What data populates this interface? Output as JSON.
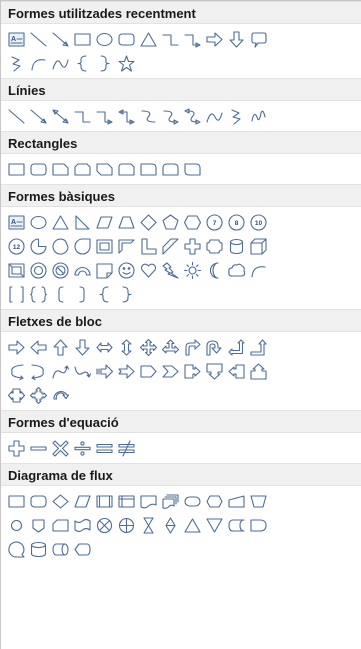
{
  "accent_color": "#4d6d95",
  "sections": [
    {
      "title": "Formes utilitzades recentment",
      "rows": [
        [
          "text-box",
          "line",
          "line-arrow",
          "rectangle",
          "oval",
          "rounded-rectangle",
          "triangle",
          "elbow-connector",
          "elbow-arrow-connector",
          "right-arrow",
          "down-arrow",
          "rounded-rectangle-callout"
        ],
        [
          "freeform",
          "arc",
          "curve",
          "left-brace",
          "right-brace",
          "star-5-point"
        ]
      ]
    },
    {
      "title": "Línies",
      "rows": [
        [
          "line",
          "line-arrow",
          "line-double-arrow",
          "elbow-connector",
          "elbow-arrow-connector",
          "elbow-double-arrow-connector",
          "curved-connector",
          "curved-arrow-connector",
          "curved-double-arrow-connector",
          "curve",
          "freeform",
          "scribble"
        ]
      ]
    },
    {
      "title": "Rectangles",
      "rows": [
        [
          "rectangle",
          "rounded-rectangle",
          "snip-single-corner",
          "snip-same-side",
          "snip-diagonal",
          "snip-round",
          "round-single-corner",
          "round-same-side",
          "round-diagonal"
        ]
      ]
    },
    {
      "title": "Formes bàsiques",
      "rows": [
        [
          "text-box",
          "oval",
          "triangle",
          "right-triangle",
          "parallelogram",
          "trapezoid",
          "diamond",
          "pentagon",
          "hexagon",
          "heptagon",
          "octagon",
          "decagon"
        ],
        [
          "dodecagon",
          "pie",
          "chord",
          "teardrop",
          "frame",
          "half-frame",
          "l-shape",
          "diagonal-stripe",
          "plus",
          "plaque",
          "can",
          "cube"
        ],
        [
          "bevel",
          "donut",
          "no-symbol",
          "block-arc",
          "folded-corner",
          "smiley-face",
          "heart",
          "lightning-bolt",
          "sun",
          "moon",
          "cloud",
          "arc"
        ],
        [
          "double-bracket",
          "double-brace",
          "left-bracket",
          "right-bracket",
          "left-brace",
          "right-brace"
        ]
      ]
    },
    {
      "title": "Fletxes de bloc",
      "rows": [
        [
          "right-arrow",
          "left-arrow",
          "up-arrow",
          "down-arrow",
          "left-right-arrow",
          "up-down-arrow",
          "quad-arrow",
          "left-right-up-arrow",
          "bent-arrow",
          "u-turn-arrow",
          "left-up-arrow",
          "bent-up-arrow"
        ],
        [
          "curved-right-arrow",
          "curved-left-arrow",
          "curved-up-arrow",
          "curved-down-arrow",
          "striped-right-arrow",
          "notched-right-arrow",
          "pentagon-arrow",
          "chevron",
          "right-arrow-callout",
          "down-arrow-callout",
          "left-arrow-callout",
          "up-arrow-callout"
        ],
        [
          "left-right-arrow-callout",
          "quad-arrow-callout",
          "circular-arrow"
        ]
      ]
    },
    {
      "title": "Formes d'equació",
      "rows": [
        [
          "plus",
          "minus",
          "multiply",
          "divide",
          "equal",
          "not-equal"
        ]
      ]
    },
    {
      "title": "Diagrama de flux",
      "rows": [
        [
          "flowchart-process",
          "flowchart-alternate-process",
          "flowchart-decision",
          "flowchart-data",
          "flowchart-predefined-process",
          "flowchart-internal-storage",
          "flowchart-document",
          "flowchart-multidocument",
          "flowchart-terminator",
          "flowchart-preparation",
          "flowchart-manual-input",
          "flowchart-manual-operation"
        ],
        [
          "flowchart-connector",
          "flowchart-offpage-connector",
          "flowchart-card",
          "flowchart-punched-tape",
          "flowchart-summing-junction",
          "flowchart-or",
          "flowchart-collate",
          "flowchart-sort",
          "flowchart-extract",
          "flowchart-merge",
          "flowchart-stored-data",
          "flowchart-delay"
        ],
        [
          "flowchart-sequential-access-storage",
          "flowchart-magnetic-disk",
          "flowchart-direct-access-storage",
          "flowchart-display"
        ]
      ]
    }
  ],
  "numbered_labels": {
    "heptagon": "7",
    "octagon": "8",
    "decagon": "10",
    "dodecagon": "12"
  }
}
